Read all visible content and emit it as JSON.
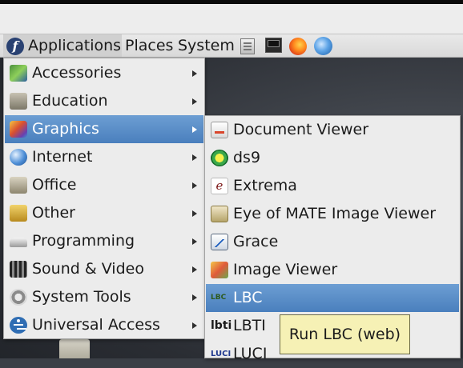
{
  "panel": {
    "applications_label": "Applications",
    "places_label": "Places",
    "system_label": "System",
    "launchers": [
      "files-launcher",
      "terminal-launcher",
      "firefox-launcher",
      "thunderbird-launcher"
    ]
  },
  "apps_menu": {
    "items": [
      {
        "label": "Accessories",
        "icon": "accessories-icon",
        "has_submenu": true
      },
      {
        "label": "Education",
        "icon": "education-icon",
        "has_submenu": true
      },
      {
        "label": "Graphics",
        "icon": "graphics-icon",
        "has_submenu": true,
        "active": true
      },
      {
        "label": "Internet",
        "icon": "internet-icon",
        "has_submenu": true
      },
      {
        "label": "Office",
        "icon": "office-icon",
        "has_submenu": true
      },
      {
        "label": "Other",
        "icon": "other-icon",
        "has_submenu": true
      },
      {
        "label": "Programming",
        "icon": "programming-icon",
        "has_submenu": true
      },
      {
        "label": "Sound & Video",
        "icon": "sound-video-icon",
        "has_submenu": true
      },
      {
        "label": "System Tools",
        "icon": "system-tools-icon",
        "has_submenu": true
      },
      {
        "label": "Universal Access",
        "icon": "universal-access-icon",
        "has_submenu": true
      }
    ]
  },
  "graphics_menu": {
    "items": [
      {
        "label": "Document Viewer",
        "icon": "document-viewer-icon"
      },
      {
        "label": "ds9",
        "icon": "ds9-icon"
      },
      {
        "label": "Extrema",
        "icon": "extrema-icon",
        "icon_text": "e"
      },
      {
        "label": "Eye of MATE Image Viewer",
        "icon": "eye-of-mate-icon"
      },
      {
        "label": "Grace",
        "icon": "grace-icon"
      },
      {
        "label": "Image Viewer",
        "icon": "image-viewer-icon"
      },
      {
        "label": "LBC",
        "icon": "lbc-icon",
        "icon_text": "LBC",
        "active": true
      },
      {
        "label": "LBTI",
        "icon": "lbti-icon",
        "icon_text": "lbti"
      },
      {
        "label": "LUCI",
        "icon": "luci-icon",
        "icon_text": "LUCI"
      }
    ]
  },
  "tooltip": {
    "text": "Run LBC (web)"
  },
  "colors": {
    "selection": "#4a7fbd",
    "menu_background": "#ececec",
    "tooltip_background": "#f6f1b5"
  }
}
